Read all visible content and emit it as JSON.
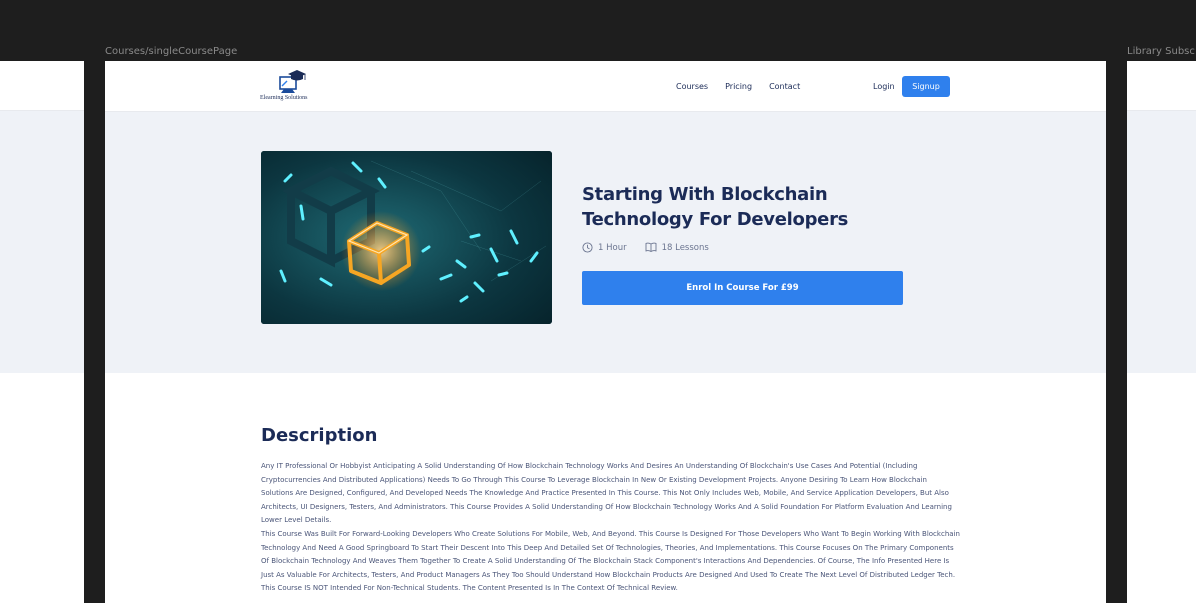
{
  "canvas": {
    "left_label": "Courses/singleCoursePage",
    "right_label": "Library Subsc"
  },
  "nav": {
    "logo_text": "Elearning Solutions",
    "links": [
      "Courses",
      "Pricing",
      "Contact"
    ],
    "login": "Login",
    "signup": "Signup"
  },
  "course": {
    "title": "Starting With Blockchain Technology For Developers",
    "duration": "1 Hour",
    "lessons": "18 Lessons",
    "enrol_label": "Enrol In Course For £99"
  },
  "description": {
    "heading": "Description",
    "paragraphs": [
      "Any IT Professional Or Hobbyist Anticipating A Solid Understanding Of How Blockchain Technology Works And Desires An Understanding Of Blockchain's Use Cases And Potential (Including Cryptocurrencies And Distributed Applications) Needs To Go Through This Course To Leverage Blockchain In New Or Existing Development Projects. Anyone Desiring To Learn How Blockchain Solutions Are Designed, Configured, And Developed Needs The Knowledge And Practice Presented In This Course. This Not Only Includes Web, Mobile, And Service Application Developers, But Also Architects, UI Designers, Testers, And Administrators. This Course Provides A Solid Understanding Of How Blockchain Technology Works And A Solid Foundation For Platform Evaluation And Learning Lower Level Details.",
      "This Course Was Built For Forward-Looking Developers Who Create Solutions For Mobile, Web, And Beyond. This Course Is Designed For Those Developers Who Want To Begin Working With Blockchain Technology And Need A Good Springboard To Start Their Descent Into This Deep And Detailed Set Of Technologies, Theories, And Implementations. This Course Focuses On The Primary Components Of Blockchain Technology And Weaves Them Together To Create A Solid Understanding Of The Blockchain Stack Component's Interactions And Dependencies. Of Course, The Info Presented Here Is Just As Valuable For Architects, Testers, And Product Managers As They Too Should Understand How Blockchain Products Are Designed And Used To Create The Next Level Of Distributed Ledger Tech.",
      "This Course IS NOT Intended For Non-Technical Students. The Content Presented Is In The Context Of Technical Review."
    ]
  },
  "colors": {
    "primary": "#2f80ed",
    "heading": "#1b2b57",
    "hero_bg": "#eff2f7",
    "canvas_bg": "#1e1e1e"
  }
}
